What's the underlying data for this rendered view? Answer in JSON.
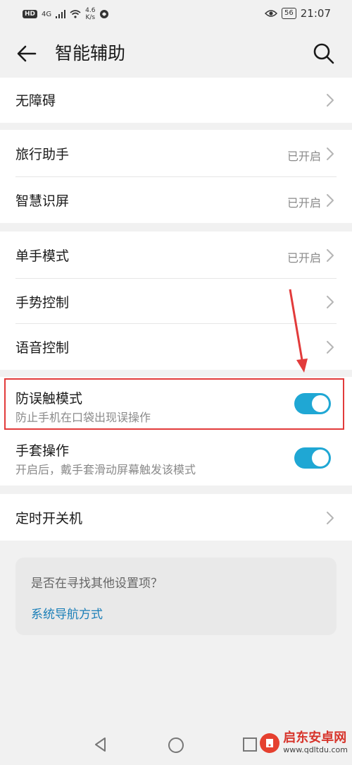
{
  "status_bar": {
    "hd": "HD",
    "network": "4G",
    "speed_top": "4.6",
    "speed_bottom": "K/s",
    "battery": "56",
    "time": "21:07"
  },
  "app_bar": {
    "title": "智能辅助"
  },
  "groups": [
    {
      "label": "无障碍"
    },
    {
      "label": "旅行助手",
      "value": "已开启"
    },
    {
      "label": "智慧识屏",
      "value": "已开启"
    },
    {
      "label": "单手模式",
      "value": "已开启"
    },
    {
      "label": "手势控制"
    },
    {
      "label": "语音控制"
    }
  ],
  "toggles": [
    {
      "label": "防误触模式",
      "subtitle": "防止手机在口袋出现误操作",
      "on": true
    },
    {
      "label": "手套操作",
      "subtitle": "开启后，戴手套滑动屏幕触发该模式",
      "on": true
    }
  ],
  "timer": {
    "label": "定时开关机"
  },
  "suggestion": {
    "question": "是否在寻找其他设置项？",
    "link": "系统导航方式"
  },
  "watermark": {
    "brand": "启东安卓网",
    "url": "www.qdltdu.com"
  },
  "colors": {
    "accent": "#1fa7d4",
    "highlight": "#e23b3b",
    "link": "#1b7fb8"
  }
}
